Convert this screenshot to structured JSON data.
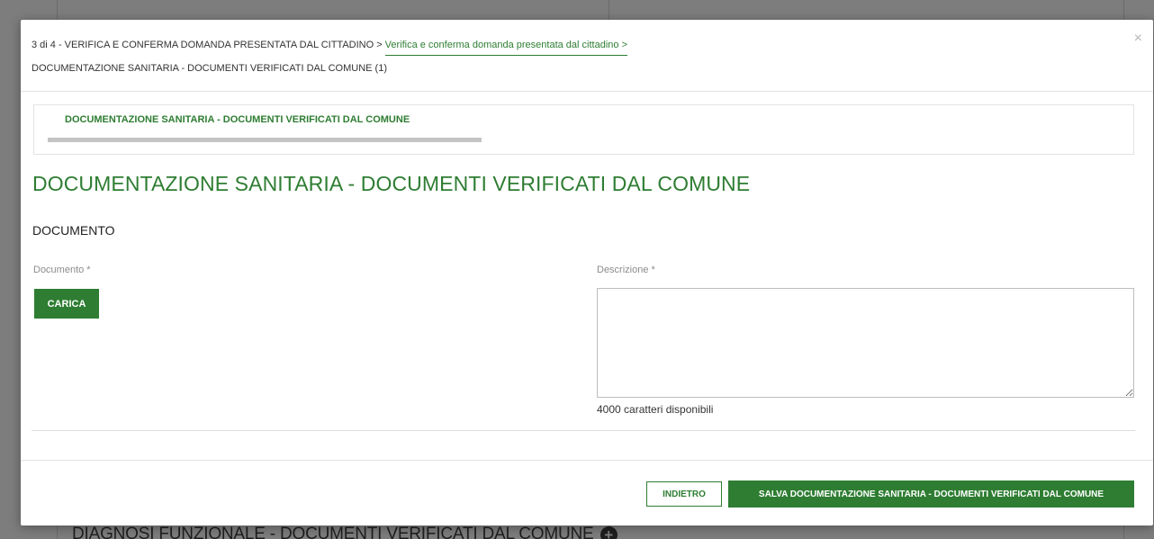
{
  "background": {
    "bottom_text": "DIAGNOSI FUNZIONALE - DOCUMENTI VERIFICATI DAL COMUNE",
    "plus_glyph": "+"
  },
  "header": {
    "step_text": "3 di 4 - VERIFICA E CONFERMA DOMANDA PRESENTATA DAL CITTADINO",
    "separator": ">",
    "crumb_link": "Verifica e conferma domanda presentata dal cittadino",
    "crumb_link_separator": ">",
    "current_page": "DOCUMENTAZIONE SANITARIA - DOCUMENTI VERIFICATI DAL COMUNE (1)",
    "close_glyph": "×"
  },
  "stepper": {
    "label": "DOCUMENTAZIONE SANITARIA - DOCUMENTI VERIFICATI DAL COMUNE"
  },
  "main": {
    "title": "DOCUMENTAZIONE SANITARIA - DOCUMENTI VERIFICATI DAL COMUNE",
    "subtitle": "DOCUMENTO",
    "documento_label": "Documento *",
    "carica_label": "CARICA",
    "descrizione_label": "Descrizione *",
    "descrizione_value": "",
    "char_count": "4000 caratteri disponibili"
  },
  "footer": {
    "back_label": "INDIETRO",
    "save_label": "SALVA DOCUMENTAZIONE SANITARIA - DOCUMENTI VERIFICATI DAL COMUNE"
  },
  "colors": {
    "accent": "#2e7d32",
    "overlay": "#7d7d7d"
  }
}
